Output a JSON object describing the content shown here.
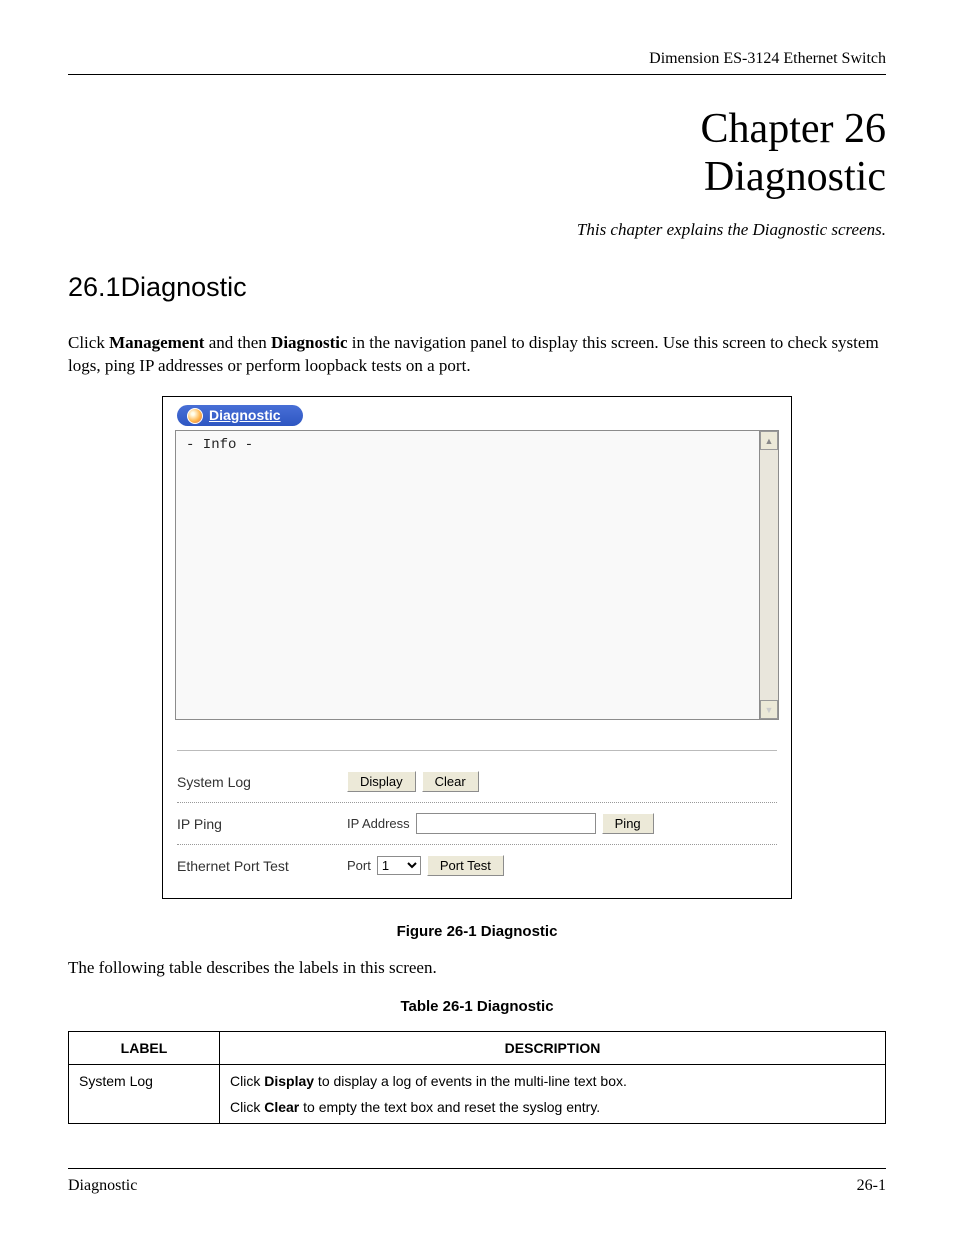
{
  "header": {
    "running_title": "Dimension ES-3124 Ethernet Switch"
  },
  "chapter": {
    "number_line": "Chapter 26",
    "title_line": "Diagnostic",
    "intro": "This chapter explains the Diagnostic screens."
  },
  "section": {
    "number": "26.1",
    "title": "Diagnostic"
  },
  "paragraphs": {
    "p1_pre": "Click ",
    "p1_bold1": "Management",
    "p1_mid": " and then ",
    "p1_bold2": "Diagnostic",
    "p1_post": " in the navigation panel to display this screen. Use this screen to check system logs, ping IP addresses or perform loopback tests on a port.",
    "p2": "The following table describes the labels in this screen."
  },
  "screenshot": {
    "tab_label": "Diagnostic",
    "info_text": "- Info -",
    "rows": {
      "system_log": {
        "label": "System Log",
        "btn_display": "Display",
        "btn_clear": "Clear"
      },
      "ip_ping": {
        "label": "IP Ping",
        "field_label": "IP Address",
        "ip_value": "",
        "btn_ping": "Ping"
      },
      "port_test": {
        "label": "Ethernet Port Test",
        "field_label": "Port",
        "port_value": "1",
        "btn_test": "Port Test"
      }
    }
  },
  "figure_caption": "Figure 26-1 Diagnostic",
  "table_caption": "Table 26-1 Diagnostic",
  "table": {
    "head_label": "LABEL",
    "head_desc": "DESCRIPTION",
    "rows": [
      {
        "label": "System Log",
        "desc_parts": {
          "l1_pre": "Click ",
          "l1_b": "Display",
          "l1_post": " to display a log of events in the multi-line text box.",
          "l2_pre": "Click ",
          "l2_b": "Clear",
          "l2_post": " to empty the text box and reset the syslog entry."
        }
      }
    ]
  },
  "footer": {
    "left": "Diagnostic",
    "right": "26-1"
  }
}
